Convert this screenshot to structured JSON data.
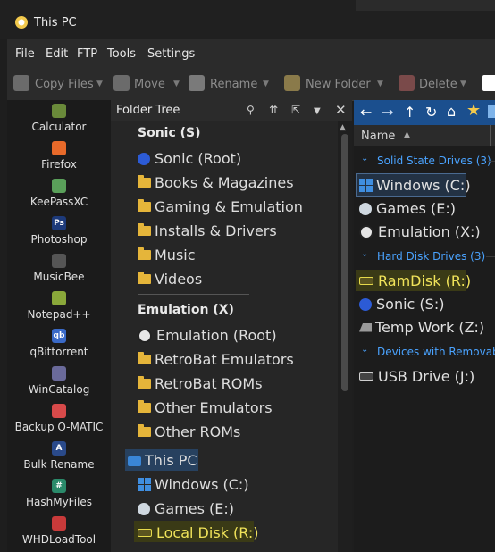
{
  "window": {
    "title": "This PC"
  },
  "menubar": [
    "File",
    "Edit",
    "FTP",
    "Tools",
    "Settings"
  ],
  "toolbar": {
    "copy_files": "Copy Files",
    "move": "Move",
    "rename": "Rename",
    "new_folder": "New Folder",
    "delete": "Delete"
  },
  "launcher": [
    {
      "label": "Calculator",
      "icon": "calculator-icon"
    },
    {
      "label": "Firefox",
      "icon": "firefox-icon"
    },
    {
      "label": "KeePassXC",
      "icon": "keepassxc-icon"
    },
    {
      "label": "Photoshop",
      "icon": "photoshop-icon",
      "glyph": "Ps"
    },
    {
      "label": "MusicBee",
      "icon": "musicbee-icon"
    },
    {
      "label": "Notepad++",
      "icon": "notepadpp-icon"
    },
    {
      "label": "qBittorrent",
      "icon": "qbittorrent-icon",
      "glyph": "qb"
    },
    {
      "label": "WinCatalog",
      "icon": "wincatalog-icon"
    },
    {
      "label": "Backup O-MATIC",
      "icon": "backup-omatic-icon"
    },
    {
      "label": "Bulk Rename",
      "icon": "bulk-rename-icon",
      "glyph": "A"
    },
    {
      "label": "HashMyFiles",
      "icon": "hashmyfiles-icon",
      "glyph": "#"
    },
    {
      "label": "WHDLoadTool",
      "icon": "whdloadtool-icon"
    }
  ],
  "folder_tree": {
    "title": "Folder Tree",
    "sonic": {
      "heading": "Sonic (S)",
      "items": [
        "Sonic (Root)",
        "Books & Magazines",
        "Gaming & Emulation",
        "Installs & Drivers",
        "Music",
        "Videos"
      ]
    },
    "emulation": {
      "heading": "Emulation (X)",
      "items": [
        "Emulation (Root)",
        "RetroBat Emulators",
        "RetroBat ROMs",
        "Other Emulators",
        "Other ROMs"
      ]
    },
    "this_pc": {
      "label": "This PC",
      "items": [
        "Windows (C:)",
        "Games (E:)",
        "Local Disk (R:)"
      ]
    }
  },
  "file_list": {
    "column_name": "Name",
    "groups": [
      {
        "title": "Solid State Drives (3)",
        "items": [
          "Windows (C:)",
          "Games (E:)",
          "Emulation (X:)"
        ]
      },
      {
        "title": "Hard Disk Drives (3)",
        "items": [
          "RamDisk (R:)",
          "Sonic (S:)",
          "Temp Work (Z:)"
        ]
      },
      {
        "title": "Devices with Removabl",
        "items": [
          "USB Drive (J:)"
        ]
      }
    ]
  },
  "colors": {
    "accent_blue": "#1b4f8e",
    "group_text": "#4aa3ff",
    "highlight_yellow": "#e5d94b",
    "folder_yellow": "#e5b53a"
  }
}
